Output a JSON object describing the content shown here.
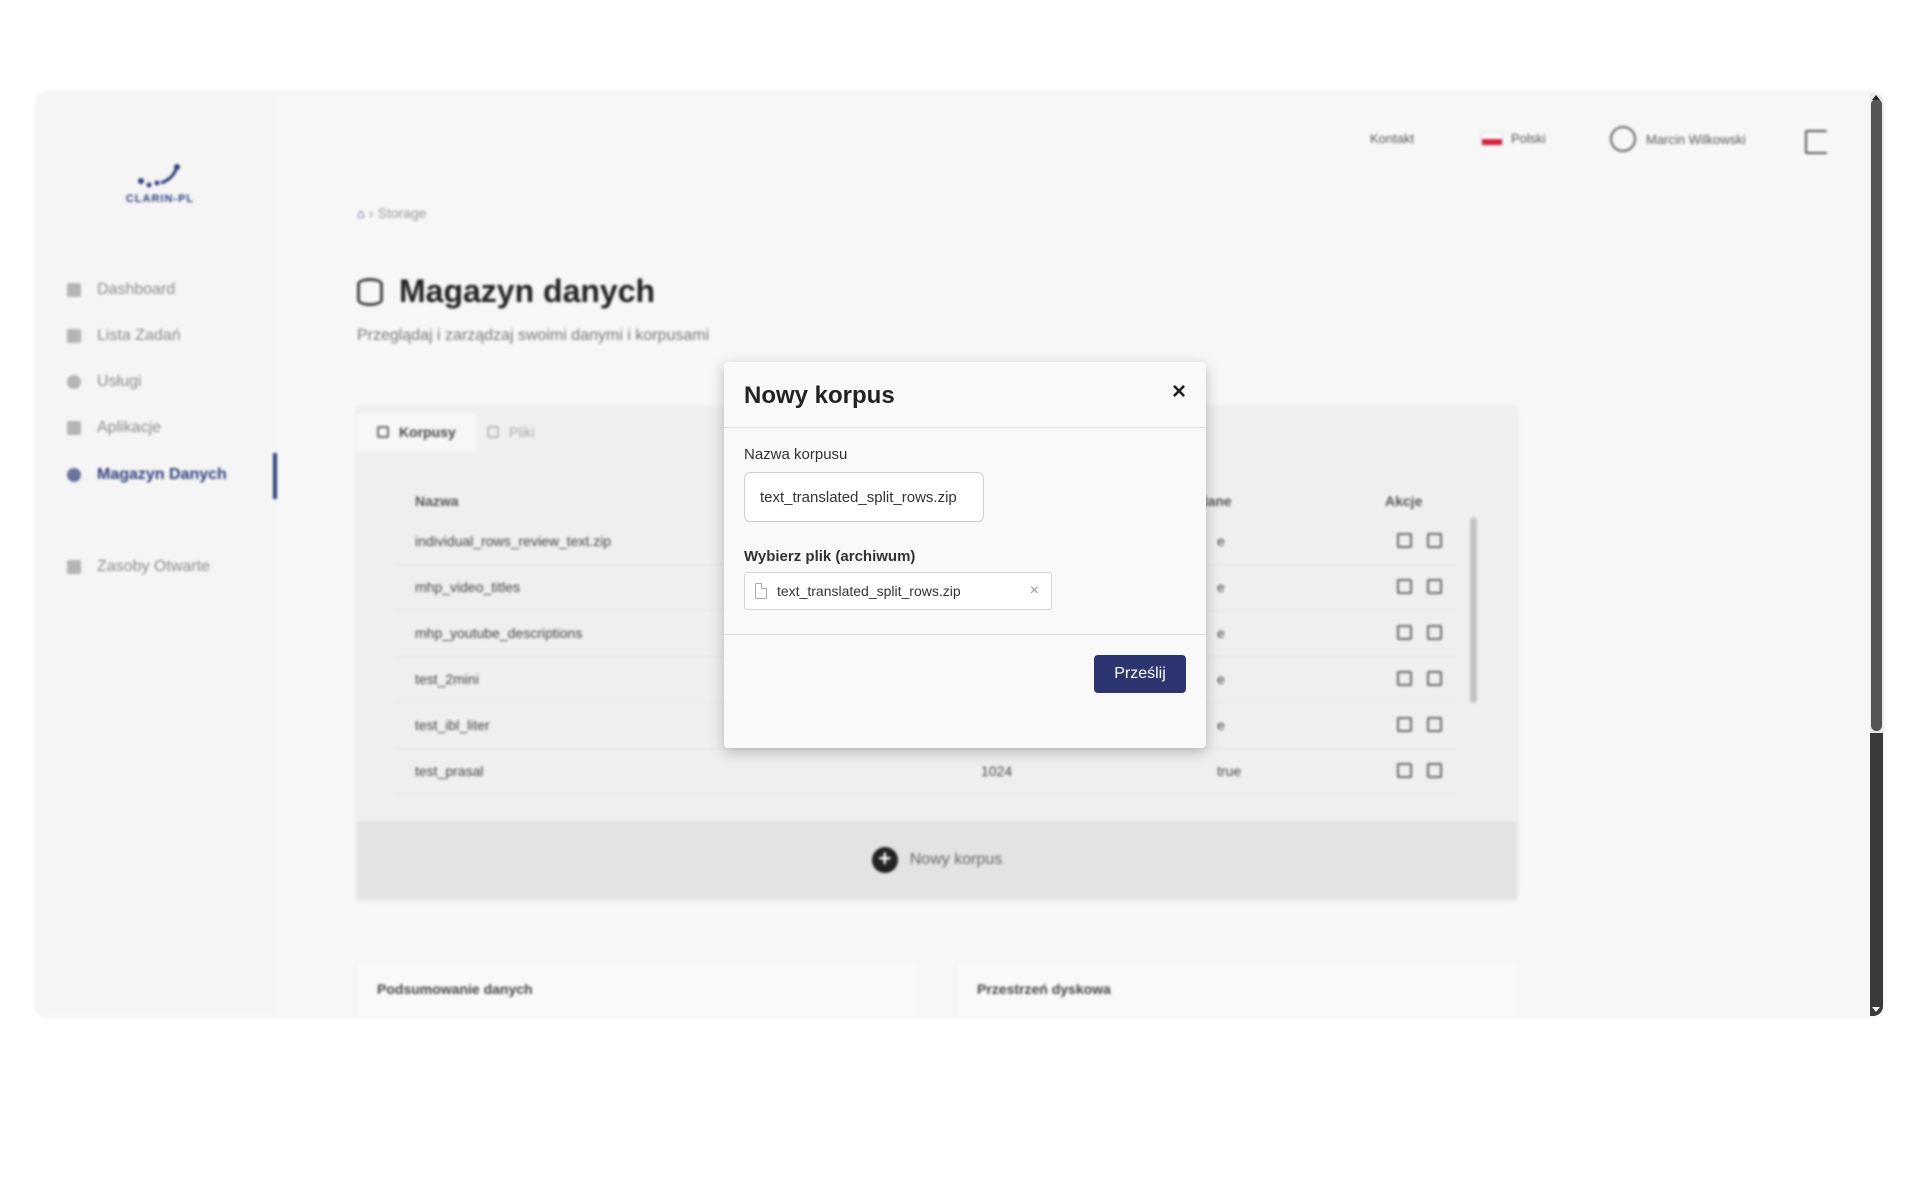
{
  "sidebar": {
    "logo_text": "CLARIN-PL",
    "items": [
      {
        "label": "Dashboard"
      },
      {
        "label": "Lista Zadań"
      },
      {
        "label": "Usługi"
      },
      {
        "label": "Aplikacje"
      },
      {
        "label": "Magazyn Danych",
        "active": true
      },
      {
        "label": "Zasoby Otwarte"
      }
    ]
  },
  "header": {
    "contact": "Kontakt",
    "language": "Polski",
    "user": "Marcin Wilkowski"
  },
  "breadcrumb": {
    "current": "Storage"
  },
  "page": {
    "title": "Magazyn danych",
    "subtitle": "Przeglądaj i zarządzaj swoimi danymi i korpusami"
  },
  "tabs": [
    "Korpusy",
    "Pliki"
  ],
  "table": {
    "columns": {
      "name": "Nazwa",
      "data": "dane",
      "actions": "Akcje"
    },
    "rows": [
      {
        "name": "individual_rows_review_text.zip",
        "size": "",
        "flag": "e"
      },
      {
        "name": "mhp_video_titles",
        "size": "",
        "flag": "e"
      },
      {
        "name": "mhp_youtube_descriptions",
        "size": "",
        "flag": "e"
      },
      {
        "name": "test_2mini",
        "size": "",
        "flag": "e"
      },
      {
        "name": "test_ibl_liter",
        "size": "",
        "flag": "e"
      },
      {
        "name": "test_prasal",
        "size": "1024",
        "flag": "true"
      }
    ]
  },
  "card_footer": {
    "new_corpus": "Nowy korpus"
  },
  "bottom_cards": [
    "Podsumowanie danych",
    "Przestrzeń dyskowa"
  ],
  "modal": {
    "title": "Nowy korpus",
    "close_icon": "×",
    "name_label": "Nazwa korpusu",
    "name_value": "text_translated_split_rows.zip",
    "file_label": "Wybierz plik (archiwum)",
    "file_name": "text_translated_split_rows.zip",
    "remove_icon": "×",
    "submit": "Prześlij"
  },
  "colors": {
    "accent": "#2c3570",
    "brand": "#2c3d7a"
  }
}
